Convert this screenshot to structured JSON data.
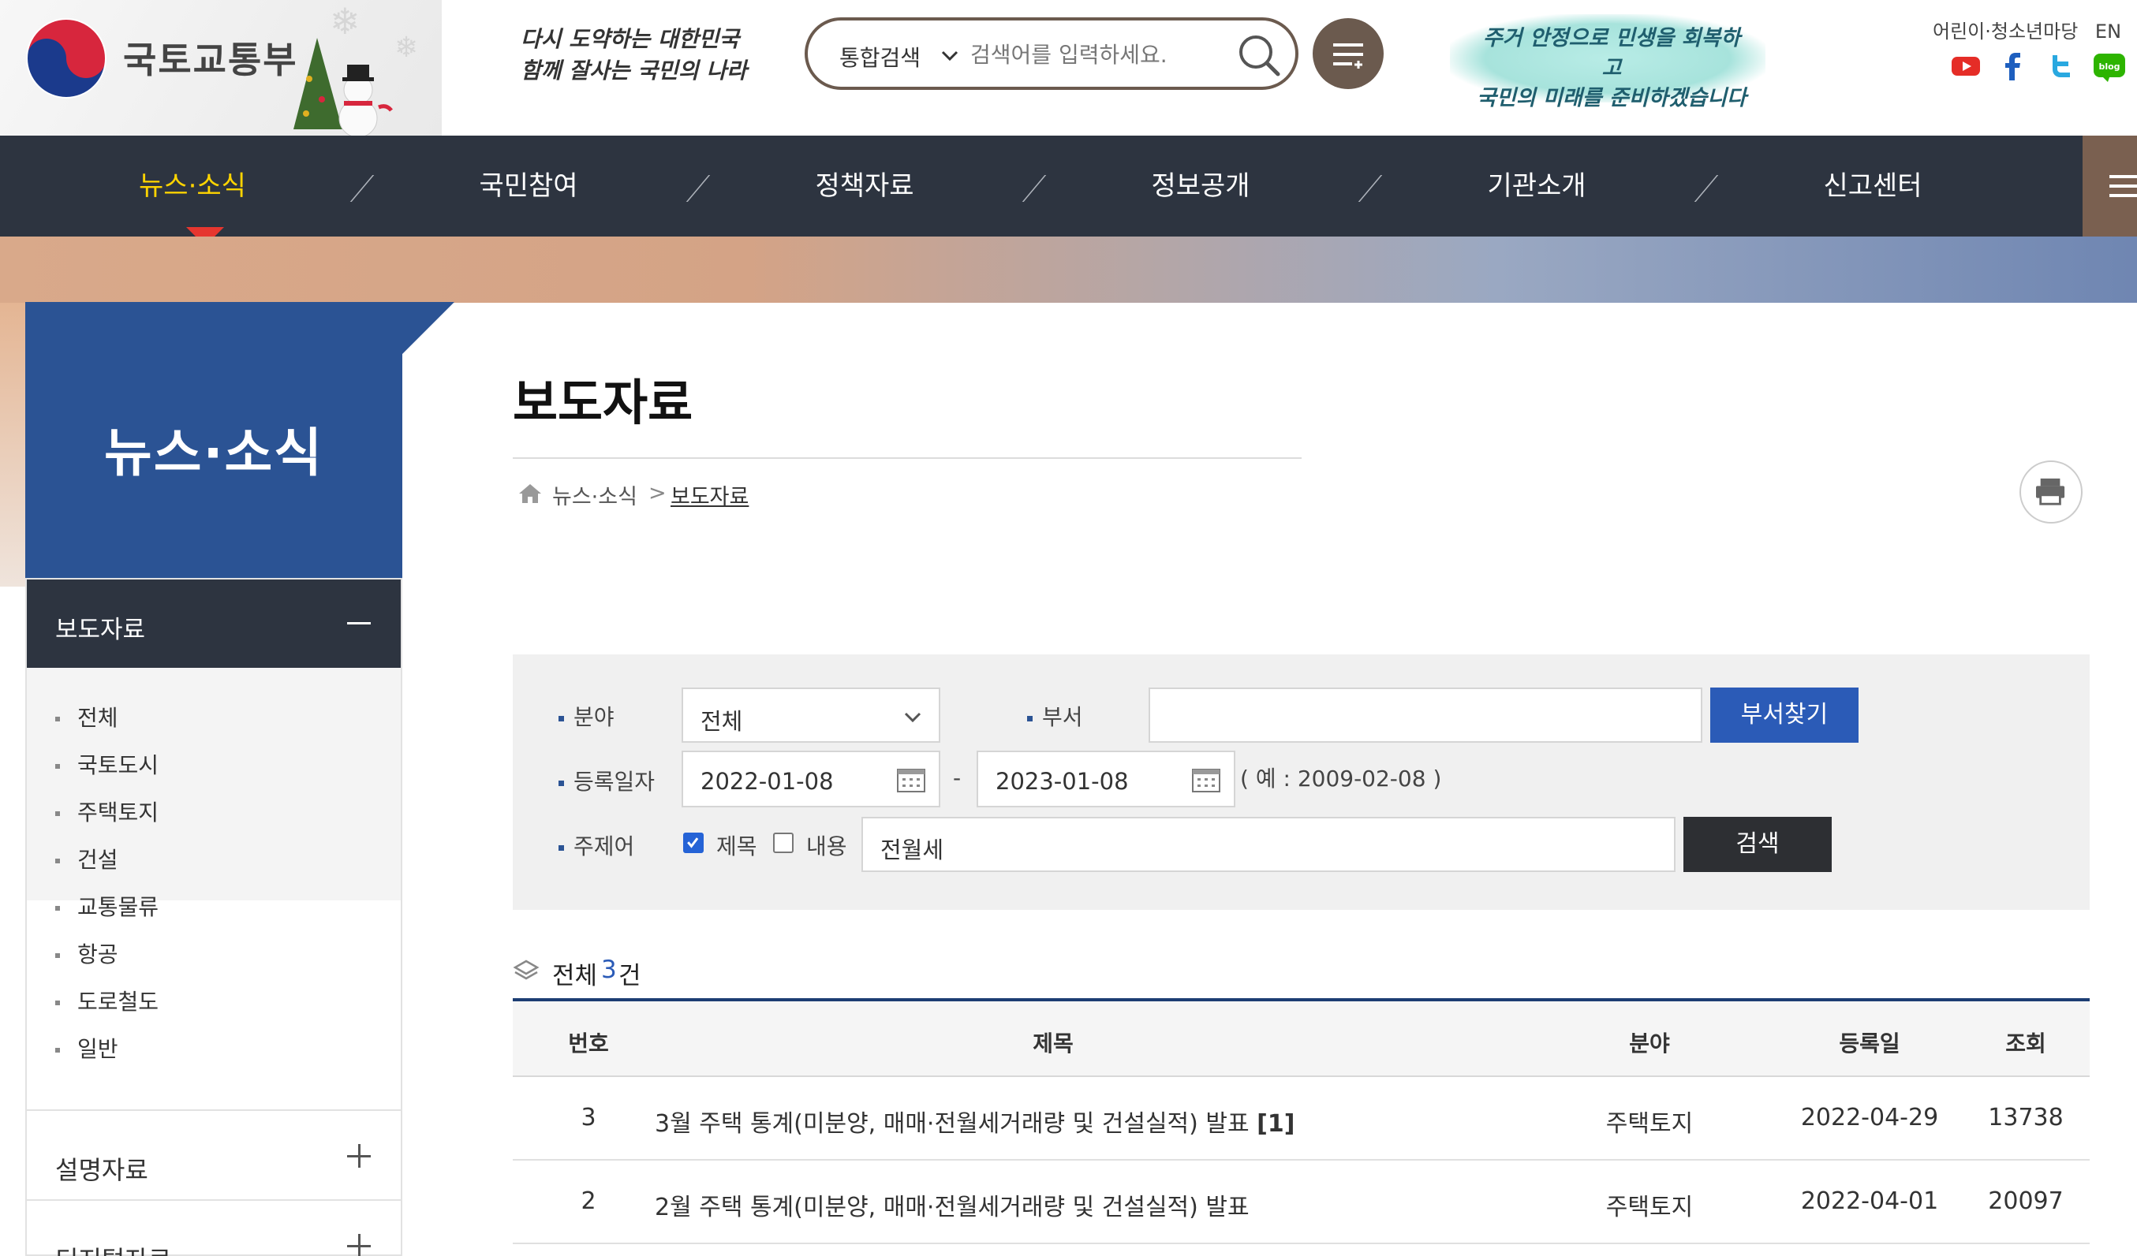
{
  "header": {
    "logo_text": "국토교통부",
    "slogan": "다시 도약하는 대한민국\n함께 잘사는 국민의 나라",
    "search": {
      "scope": "통합검색",
      "placeholder": "검색어를 입력하세요."
    },
    "campaign": "주거 안정으로 민생을 회복하고\n국민의 미래를 준비하겠습니다",
    "util_links": [
      "어린이·청소년마당",
      "EN"
    ],
    "sns": [
      "youtube-icon",
      "facebook-icon",
      "twitter-icon",
      "blog-icon"
    ],
    "sns_blog_label": "blog"
  },
  "gnb": {
    "items": [
      "뉴스·소식",
      "국민참여",
      "정책자료",
      "정보공개",
      "기관소개",
      "신고센터"
    ],
    "active_index": 0,
    "active_color": "#ffd400"
  },
  "side": {
    "title": "뉴스·소식",
    "active_group": "보도자료",
    "sub_items": [
      "전체",
      "국토도시",
      "주택토지",
      "건설",
      "교통물류",
      "항공",
      "도로철도",
      "일반"
    ],
    "groups": [
      "설명자료",
      "디지털자료"
    ]
  },
  "content": {
    "page_title": "보도자료",
    "breadcrumb": [
      "뉴스·소식",
      "보도자료"
    ],
    "breadcrumb_sep": ">"
  },
  "search_form": {
    "field_label": "분야",
    "field_value": "전체",
    "dept_label": "부서",
    "dept_value": "",
    "dept_button": "부서찾기",
    "date_label": "등록일자",
    "date_from": "2022-01-08",
    "date_sep": "-",
    "date_to": "2023-01-08",
    "date_example": "( 예 : 2009-02-08 )",
    "keyword_label": "주제어",
    "check_title_label": "제목",
    "check_title_checked": true,
    "check_content_label": "내용",
    "check_content_checked": false,
    "keyword_value": "전월세",
    "search_button": "검색"
  },
  "results": {
    "total_label": "전체",
    "total_count": "3",
    "total_unit": "건",
    "columns": [
      "번호",
      "제목",
      "분야",
      "등록일",
      "조회"
    ],
    "rows": [
      {
        "no": "3",
        "title": "3월 주택 통계(미분양, 매매·전월세거래량 및 건설실적) 발표",
        "attach": "[1]",
        "field": "주택토지",
        "date": "2022-04-29",
        "views": "13738"
      },
      {
        "no": "2",
        "title": "2월 주택 통계(미분양, 매매·전월세거래량 및 건설실적) 발표",
        "attach": "",
        "field": "주택토지",
        "date": "2022-04-01",
        "views": "20097"
      }
    ]
  },
  "colors": {
    "nav_bg": "#2d3440",
    "side_title_bg": "#2b5394",
    "primary_button": "#2b5bb7",
    "table_top_border": "#1c3d73",
    "search_border": "#6b5a4e"
  }
}
